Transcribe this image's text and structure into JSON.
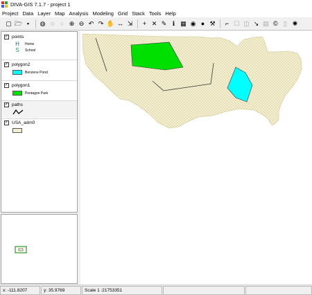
{
  "window": {
    "title": "DIVA-GIS 7.1.7 - project 1"
  },
  "menus": [
    "Project",
    "Data",
    "Layer",
    "Map",
    "Analysis",
    "Modeling",
    "Grid",
    "Stack",
    "Tools",
    "Help"
  ],
  "toolbar": {
    "icons": [
      {
        "name": "new-project-icon",
        "glyph": "▢"
      },
      {
        "name": "open-folder-icon",
        "glyph": "🗁"
      },
      {
        "name": "save-icon",
        "glyph": "▪"
      },
      {
        "name": "globe-icon",
        "glyph": "◍"
      },
      {
        "name": "zoom-world-icon",
        "glyph": "◌"
      },
      {
        "name": "zoom-extent-icon",
        "glyph": "○",
        "dim": true
      },
      {
        "name": "zoom-in-icon",
        "glyph": "⊕"
      },
      {
        "name": "zoom-out-icon",
        "glyph": "⊖"
      },
      {
        "name": "undo-icon",
        "glyph": "↶"
      },
      {
        "name": "redo-icon",
        "glyph": "↷"
      },
      {
        "name": "pan-hand-icon",
        "glyph": "✋"
      },
      {
        "name": "measure-icon",
        "glyph": "↔"
      },
      {
        "name": "move-icon",
        "glyph": "⇲"
      },
      {
        "name": "add-layer-icon",
        "glyph": "+"
      },
      {
        "name": "remove-layer-icon",
        "glyph": "✕"
      },
      {
        "name": "pencil-icon",
        "glyph": "✎"
      },
      {
        "name": "identify-icon",
        "glyph": "ℹ"
      },
      {
        "name": "table-icon",
        "glyph": "▦"
      },
      {
        "name": "earth-icon",
        "glyph": "◉"
      },
      {
        "name": "info-icon",
        "glyph": "●"
      },
      {
        "name": "tools-icon",
        "glyph": "⚒"
      },
      {
        "name": "select-icon",
        "glyph": "⌐"
      },
      {
        "name": "box-icon",
        "glyph": "☐",
        "dim": true
      },
      {
        "name": "clear-icon",
        "glyph": "◫",
        "dim": true
      },
      {
        "name": "graph-icon",
        "glyph": "↘"
      },
      {
        "name": "grid-icon",
        "glyph": "▤",
        "dim": true
      },
      {
        "name": "copyright-icon",
        "glyph": "©"
      },
      {
        "name": "blank-icon",
        "glyph": "▯",
        "dim": true
      },
      {
        "name": "settings-icon",
        "glyph": "✺"
      }
    ]
  },
  "layers": [
    {
      "key": "points",
      "name": "points",
      "checked": true,
      "legend": [
        {
          "glyph": "H",
          "color": "#1f5f8b",
          "label": "Home"
        },
        {
          "glyph": "S",
          "color": "#1aa06a",
          "label": "School"
        }
      ]
    },
    {
      "key": "polygon2",
      "name": "polygon2",
      "checked": true,
      "legend": [
        {
          "fill": "#00ffff",
          "label": "Benzene Pond"
        }
      ]
    },
    {
      "key": "polygon1",
      "name": "polygon1",
      "checked": true,
      "legend": [
        {
          "fill": "#00e000",
          "label": "Pentagon Park"
        }
      ]
    },
    {
      "key": "paths",
      "name": "paths",
      "checked": true,
      "legend": [
        {
          "line": true,
          "label": ""
        }
      ]
    },
    {
      "key": "usa",
      "name": "USA_adm0",
      "checked": true,
      "legend": [
        {
          "fill": "#f2eed2",
          "label": ""
        }
      ]
    }
  ],
  "overview": {
    "extent_box": true
  },
  "map": {
    "background": "#ffffff",
    "country_fill": "#f2eed2",
    "hatch_color": "#d9d29a",
    "park_color": "#00e000",
    "pond_color": "#00ffff",
    "path_color": "#333333"
  },
  "statusbar": {
    "x": "x: -111.8207",
    "y": "y: 35.9769",
    "scale": "Scale 1 :21753351",
    "blank1": "",
    "blank2": ""
  }
}
